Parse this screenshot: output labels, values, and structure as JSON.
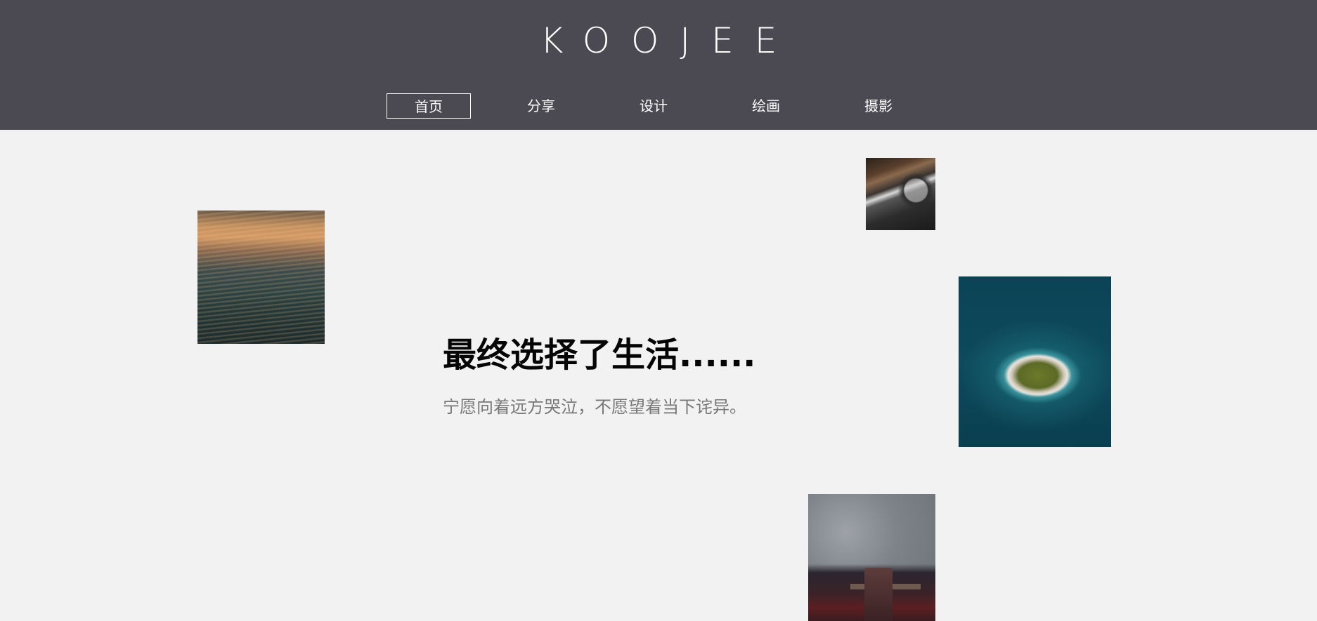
{
  "header": {
    "logo": "KOOJEE",
    "nav": [
      {
        "label": "首页",
        "active": true
      },
      {
        "label": "分享",
        "active": false
      },
      {
        "label": "设计",
        "active": false
      },
      {
        "label": "绘画",
        "active": false
      },
      {
        "label": "摄影",
        "active": false
      }
    ]
  },
  "hero": {
    "title": "最终选择了生活......",
    "subtitle": "宁愿向着远方哭泣，不愿望着当下诧异。"
  },
  "colors": {
    "header_bg": "#4b4952",
    "page_bg": "#f2f2f2",
    "title": "#050505",
    "subtitle": "#777777"
  }
}
